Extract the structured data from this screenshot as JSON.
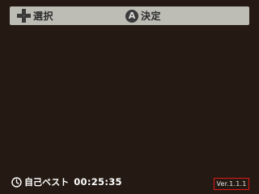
{
  "hints": {
    "select_label": "選択",
    "select_icon": "dpad-icon",
    "confirm_label": "決定",
    "confirm_icon_text": "A"
  },
  "best": {
    "label": "自己ベスト",
    "time": "00:25:35",
    "icon": "clock-icon"
  },
  "version": "Ver.1.1.1",
  "colors": {
    "background": "#241a13",
    "hint_bar": "#bdbdb6",
    "version_border": "#e01818"
  }
}
